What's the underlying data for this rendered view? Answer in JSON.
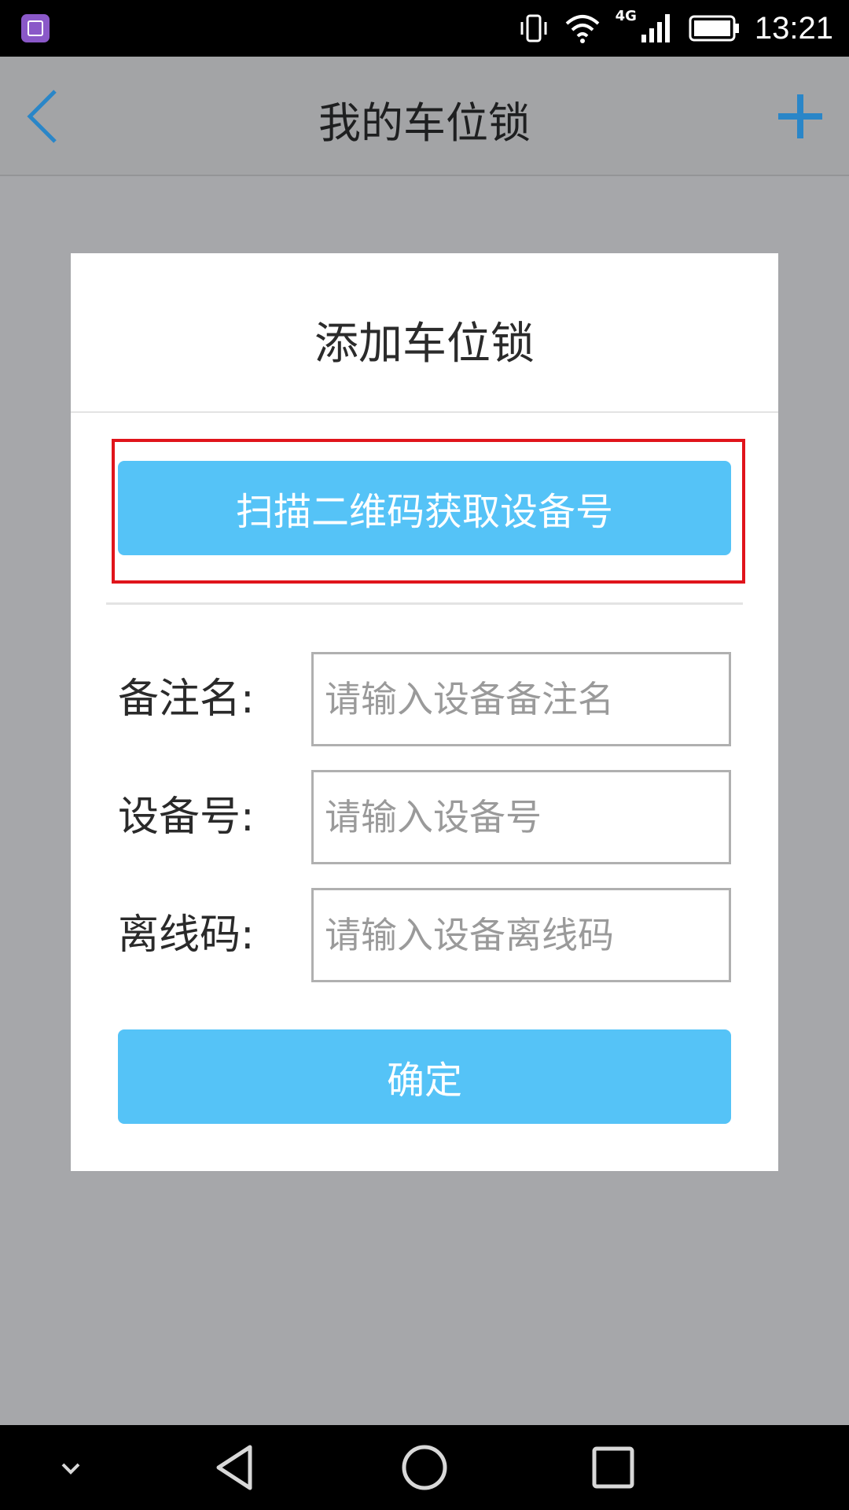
{
  "status_bar": {
    "time": "13:21",
    "network": "4G",
    "icons": [
      "gallery-icon",
      "vibrate-icon",
      "wifi-icon",
      "signal-icon",
      "battery-icon"
    ]
  },
  "app_bar": {
    "title": "我的车位锁",
    "back_icon": "chevron-left-icon",
    "add_icon": "plus-icon",
    "accent_color": "#2a86c8"
  },
  "dialog": {
    "title": "添加车位锁",
    "scan_button": "扫描二维码获取设备号",
    "fields": [
      {
        "label": "备注名:",
        "placeholder": "请输入设备备注名",
        "value": ""
      },
      {
        "label": "设备号:",
        "placeholder": "请输入设备号",
        "value": ""
      },
      {
        "label": "离线码:",
        "placeholder": "请输入设备离线码",
        "value": ""
      }
    ],
    "confirm_button": "确定",
    "button_color": "#55c3f7",
    "highlight_color": "#e0141b"
  },
  "nav_bar": {
    "icons": [
      "chevron-down-icon",
      "back-triangle-icon",
      "home-circle-icon",
      "recents-square-icon"
    ]
  }
}
